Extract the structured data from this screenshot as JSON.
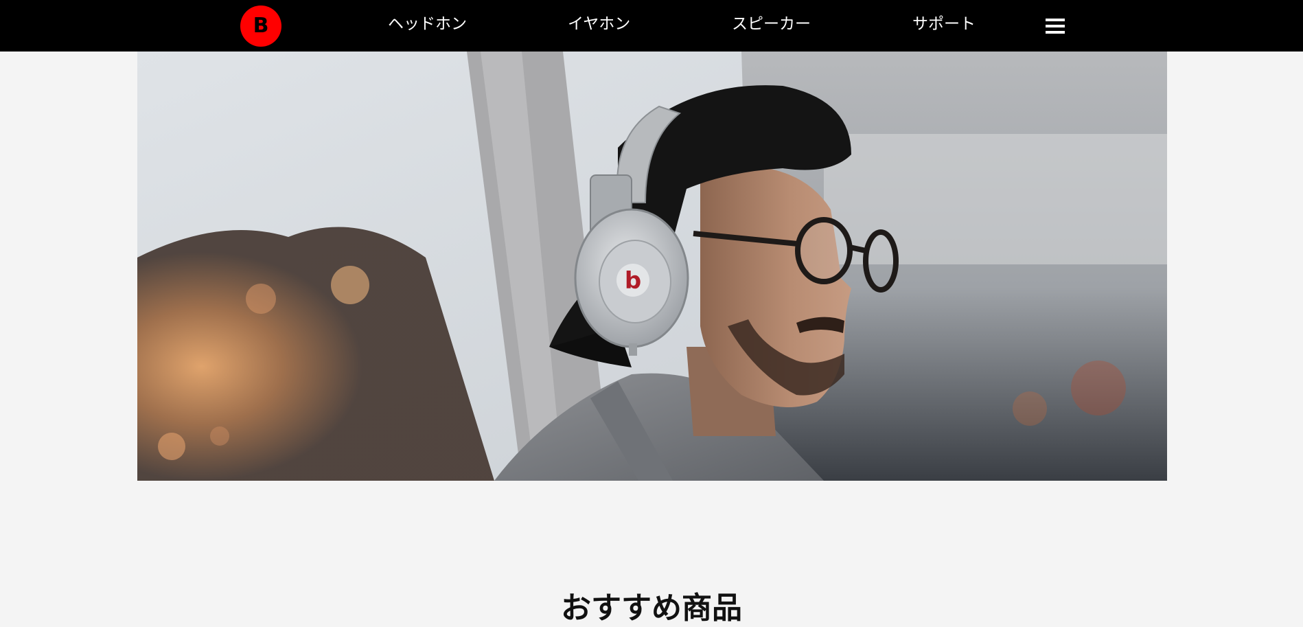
{
  "brand": {
    "logo_letter": "B",
    "logo_color": "#ff0000"
  },
  "nav": {
    "items": [
      {
        "label": "ヘッドホン"
      },
      {
        "label": "イヤホン"
      },
      {
        "label": "スピーカー"
      },
      {
        "label": "サポート"
      }
    ],
    "menu_icon": "hamburger-menu-icon",
    "background": "#000000"
  },
  "hero": {
    "image": "man-wearing-headphones-photo",
    "headphone_logo_letter": "b"
  },
  "featured": {
    "title": "おすすめ商品"
  },
  "colors": {
    "page_background": "#f4f4f4",
    "accent": "#ff0000"
  }
}
